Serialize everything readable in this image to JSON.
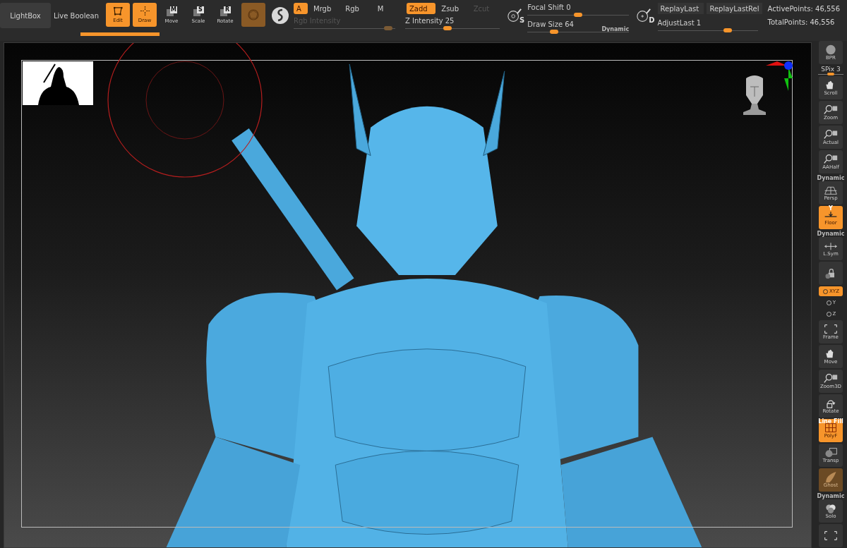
{
  "top_bar": {
    "view_buttons": [
      {
        "label": "LightBox",
        "selected": true
      },
      {
        "label": "Live Boolean",
        "selected": false
      }
    ],
    "mode_buttons": [
      {
        "label": "Edit",
        "selected": true,
        "kind": "edit"
      },
      {
        "label": "Draw",
        "selected": true,
        "kind": "draw"
      },
      {
        "label": "Move",
        "key": "M",
        "selected": false,
        "kind": "transform"
      },
      {
        "label": "Scale",
        "key": "S",
        "selected": false,
        "kind": "transform"
      },
      {
        "label": "Rotate",
        "key": "R",
        "selected": false,
        "kind": "transform"
      }
    ],
    "progress": {
      "level": 1
    },
    "color_modes": [
      {
        "label": "A",
        "selected": true,
        "disabled": false
      },
      {
        "label": "Mrgb",
        "selected": false,
        "disabled": false
      },
      {
        "label": "Rgb",
        "selected": false,
        "disabled": false
      },
      {
        "label": "M",
        "selected": false,
        "disabled": false
      }
    ],
    "depth_modes": [
      {
        "label": "Zadd",
        "selected": true,
        "disabled": false
      },
      {
        "label": "Zsub",
        "selected": false,
        "disabled": false
      },
      {
        "label": "Zcut",
        "selected": false,
        "disabled": true
      }
    ],
    "rgb_intensity": {
      "label": "Rgb Intensity",
      "level": 0.93,
      "disabled": true
    },
    "z_intensity": {
      "label": "Z Intensity 25",
      "level": 0.45,
      "disabled": false
    },
    "stroke_icon_letter": "S",
    "focal_shift": {
      "label": "Focal Shift 0",
      "level": 0.5
    },
    "draw_size": {
      "label": "Draw Size 64",
      "level": 0.26,
      "badge": "Dynamic"
    },
    "replay_icon_letter": "D",
    "replay_buttons": [
      "ReplayLast",
      "ReplayLastRel"
    ],
    "adjust_last": {
      "label": "AdjustLast 1",
      "level": 0.7
    },
    "active_points": "ActivePoints: 46,556",
    "total_points": "TotalPoints: 46,556"
  },
  "right_shelf": [
    {
      "kind": "button",
      "label": "BPR",
      "on": false,
      "disabled": false
    },
    {
      "kind": "slider",
      "label": "SPix 3",
      "level": 0.5
    },
    {
      "kind": "button",
      "label": "Scroll",
      "on": false,
      "disabled": false
    },
    {
      "kind": "button",
      "label": "Zoom",
      "on": false,
      "disabled": false
    },
    {
      "kind": "button",
      "label": "Actual",
      "on": false,
      "disabled": false
    },
    {
      "kind": "button",
      "label": "AAHalf",
      "on": false,
      "disabled": false
    },
    {
      "kind": "button",
      "label": "Persp",
      "top": "Dynamic",
      "on": false,
      "disabled": false
    },
    {
      "kind": "button",
      "label": "Floor",
      "top": "Y",
      "on": true,
      "disabled": false
    },
    {
      "kind": "button",
      "label": "L.Sym",
      "top": "Dynamic",
      "on": false,
      "disabled": false
    },
    {
      "kind": "button",
      "on": false,
      "disabled": false
    },
    {
      "kind": "small",
      "label": "XYZ",
      "on": true,
      "disabled": false
    },
    {
      "kind": "small",
      "label": "Y",
      "on": false,
      "disabled": false
    },
    {
      "kind": "small",
      "label": "Z",
      "on": false,
      "disabled": false
    },
    {
      "kind": "button",
      "label": "Frame",
      "on": false,
      "disabled": false
    },
    {
      "kind": "button",
      "label": "Move",
      "on": false,
      "disabled": false
    },
    {
      "kind": "button",
      "label": "Zoom3D",
      "on": false,
      "disabled": false
    },
    {
      "kind": "button",
      "label": "Rotate",
      "on": false,
      "disabled": false
    },
    {
      "kind": "button",
      "label": "PolyF",
      "top": "Line Fill",
      "on": true,
      "disabled": false
    },
    {
      "kind": "button",
      "label": "Transp",
      "on": false,
      "disabled": false
    },
    {
      "kind": "button",
      "label": "Ghost",
      "on": true,
      "disabled": true
    },
    {
      "kind": "button",
      "label": "Solo",
      "top": "Dynamic",
      "on": false,
      "disabled": false
    },
    {
      "kind": "button",
      "on": false,
      "disabled": false
    }
  ]
}
